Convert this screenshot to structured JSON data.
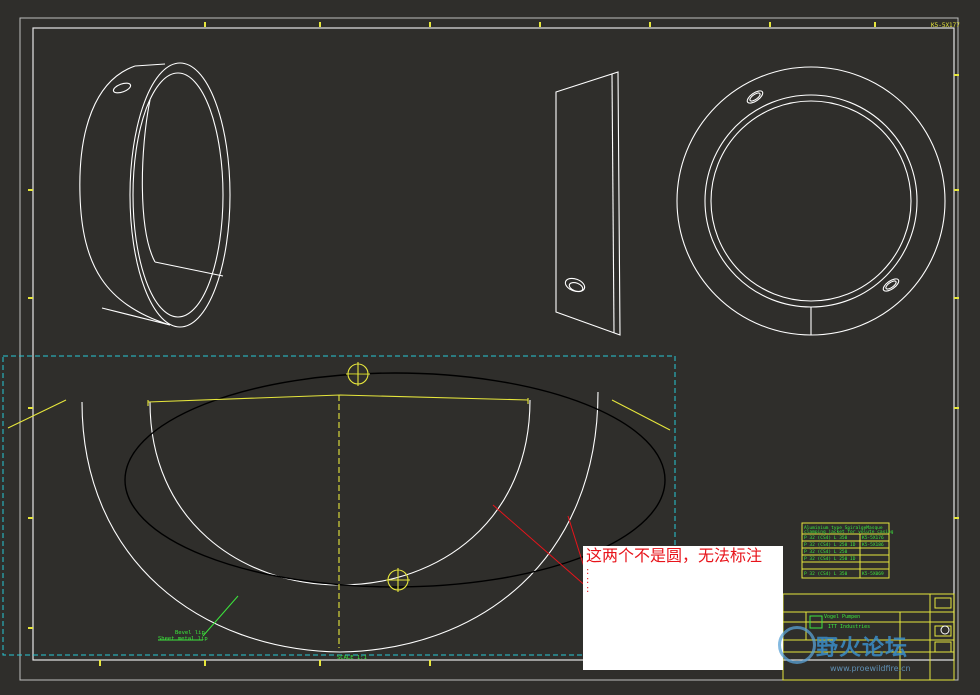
{
  "drawing": {
    "sheet_id": "K5-5X177",
    "scale_label": "SCALE 1:1",
    "leader_label_line1": "Bevel lip",
    "leader_label_line2": "Sheet metal lip"
  },
  "annotation": {
    "text": "这两个不是圆，无法标注",
    "arrow_color": "#e8141b"
  },
  "parts_table": {
    "title_line1": "Aluminium type SpiralgeMasque",
    "title_line2": "clamping jacket for volute casing",
    "rows": [
      {
        "desc": "P 32 (CS4) L 350",
        "code": "K5-5X176"
      },
      {
        "desc": "P 32 (CS4) L 250 ID",
        "code": "K5-5X186"
      },
      {
        "desc": "P 32 (CS4) L 250",
        "code": ""
      },
      {
        "desc": "P 32 (CS4) L 250 ID",
        "code": ""
      },
      {
        "desc": "P 32 (CS4) L 350",
        "code": "K5-5X069"
      }
    ]
  },
  "title_block": {
    "product": "Vogel Pumpen",
    "company": "ITT Industries"
  },
  "watermark": {
    "brand": "野火论坛",
    "url": "www.proewildfire.cn"
  },
  "colors": {
    "background": "#2f2e2b",
    "frame": "#e6e6e6",
    "geometry": "#ffffff",
    "yellow": "#e6e63c",
    "green": "#3ce63c",
    "cyan_selection": "#27c8d6",
    "red": "#e8141b"
  }
}
